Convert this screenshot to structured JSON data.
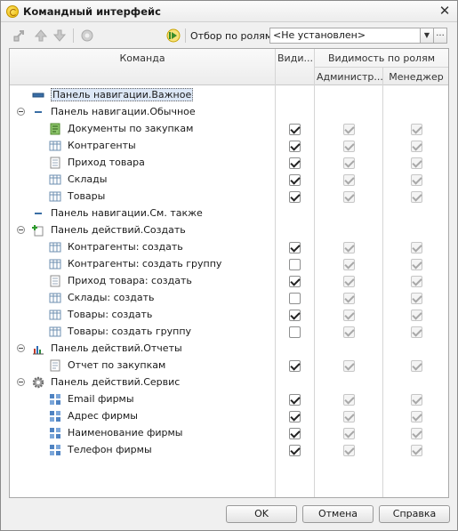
{
  "window": {
    "title": "Командный интерфейс",
    "close_glyph": "✕"
  },
  "toolbar": {
    "filter_label": "Отбор по ролям:",
    "filter_value": "<Не установлен>",
    "icons": [
      "move-to-section-icon",
      "move-up-icon",
      "move-down-icon",
      "refresh-icon",
      "play-icon"
    ]
  },
  "grid": {
    "headers": {
      "command": "Команда",
      "visible": "Види...",
      "roles_group": "Видимость по ролям",
      "role_admin": "Администр...",
      "role_manager": "Менеджер"
    },
    "rows": [
      {
        "level": 0,
        "toggle": false,
        "icon": "nav-panel-important-icon",
        "label": "Панель навигации.Важное",
        "selected": true,
        "checks": null
      },
      {
        "level": 0,
        "toggle": true,
        "icon": "nav-panel-icon",
        "label": "Панель навигации.Обычное",
        "checks": null
      },
      {
        "level": 1,
        "icon": "document-icon",
        "label": "Документы по закупкам",
        "checks": [
          true,
          true,
          true
        ]
      },
      {
        "level": 1,
        "icon": "catalog-icon",
        "label": "Контрагенты",
        "checks": [
          true,
          true,
          true
        ]
      },
      {
        "level": 1,
        "icon": "page-icon",
        "label": "Приход товара",
        "checks": [
          true,
          true,
          true
        ]
      },
      {
        "level": 1,
        "icon": "catalog-icon",
        "label": "Склады",
        "checks": [
          true,
          true,
          true
        ]
      },
      {
        "level": 1,
        "icon": "catalog-icon",
        "label": "Товары",
        "checks": [
          true,
          true,
          true
        ]
      },
      {
        "level": 0,
        "toggle": false,
        "icon": "nav-panel-icon",
        "label": "Панель навигации.См. также",
        "checks": null
      },
      {
        "level": 0,
        "toggle": true,
        "icon": "create-icon",
        "label": "Панель действий.Создать",
        "checks": null
      },
      {
        "level": 1,
        "icon": "catalog-icon",
        "label": "Контрагенты: создать",
        "checks": [
          true,
          true,
          true
        ]
      },
      {
        "level": 1,
        "icon": "catalog-icon",
        "label": "Контрагенты: создать группу",
        "checks": [
          false,
          true,
          true
        ]
      },
      {
        "level": 1,
        "icon": "page-icon",
        "label": "Приход товара: создать",
        "checks": [
          true,
          true,
          true
        ]
      },
      {
        "level": 1,
        "icon": "catalog-icon",
        "label": "Склады: создать",
        "checks": [
          false,
          true,
          true
        ]
      },
      {
        "level": 1,
        "icon": "catalog-icon",
        "label": "Товары: создать",
        "checks": [
          true,
          true,
          true
        ]
      },
      {
        "level": 1,
        "icon": "catalog-icon",
        "label": "Товары: создать группу",
        "checks": [
          false,
          true,
          true
        ]
      },
      {
        "level": 0,
        "toggle": true,
        "icon": "reports-icon",
        "label": "Панель действий.Отчеты",
        "checks": null
      },
      {
        "level": 1,
        "icon": "report-icon",
        "label": "Отчет по закупкам",
        "checks": [
          true,
          true,
          true
        ]
      },
      {
        "level": 0,
        "toggle": true,
        "icon": "gear-icon",
        "label": "Панель действий.Сервис",
        "checks": null
      },
      {
        "level": 1,
        "icon": "constant-icon",
        "label": "Email фирмы",
        "checks": [
          true,
          true,
          true
        ]
      },
      {
        "level": 1,
        "icon": "constant-icon",
        "label": "Адрес фирмы",
        "checks": [
          true,
          true,
          true
        ]
      },
      {
        "level": 1,
        "icon": "constant-icon",
        "label": "Наименование фирмы",
        "checks": [
          true,
          true,
          true
        ]
      },
      {
        "level": 1,
        "icon": "constant-icon",
        "label": "Телефон фирмы",
        "checks": [
          true,
          true,
          true
        ]
      }
    ]
  },
  "footer": {
    "ok": "OK",
    "cancel": "Отмена",
    "help": "Справка"
  }
}
